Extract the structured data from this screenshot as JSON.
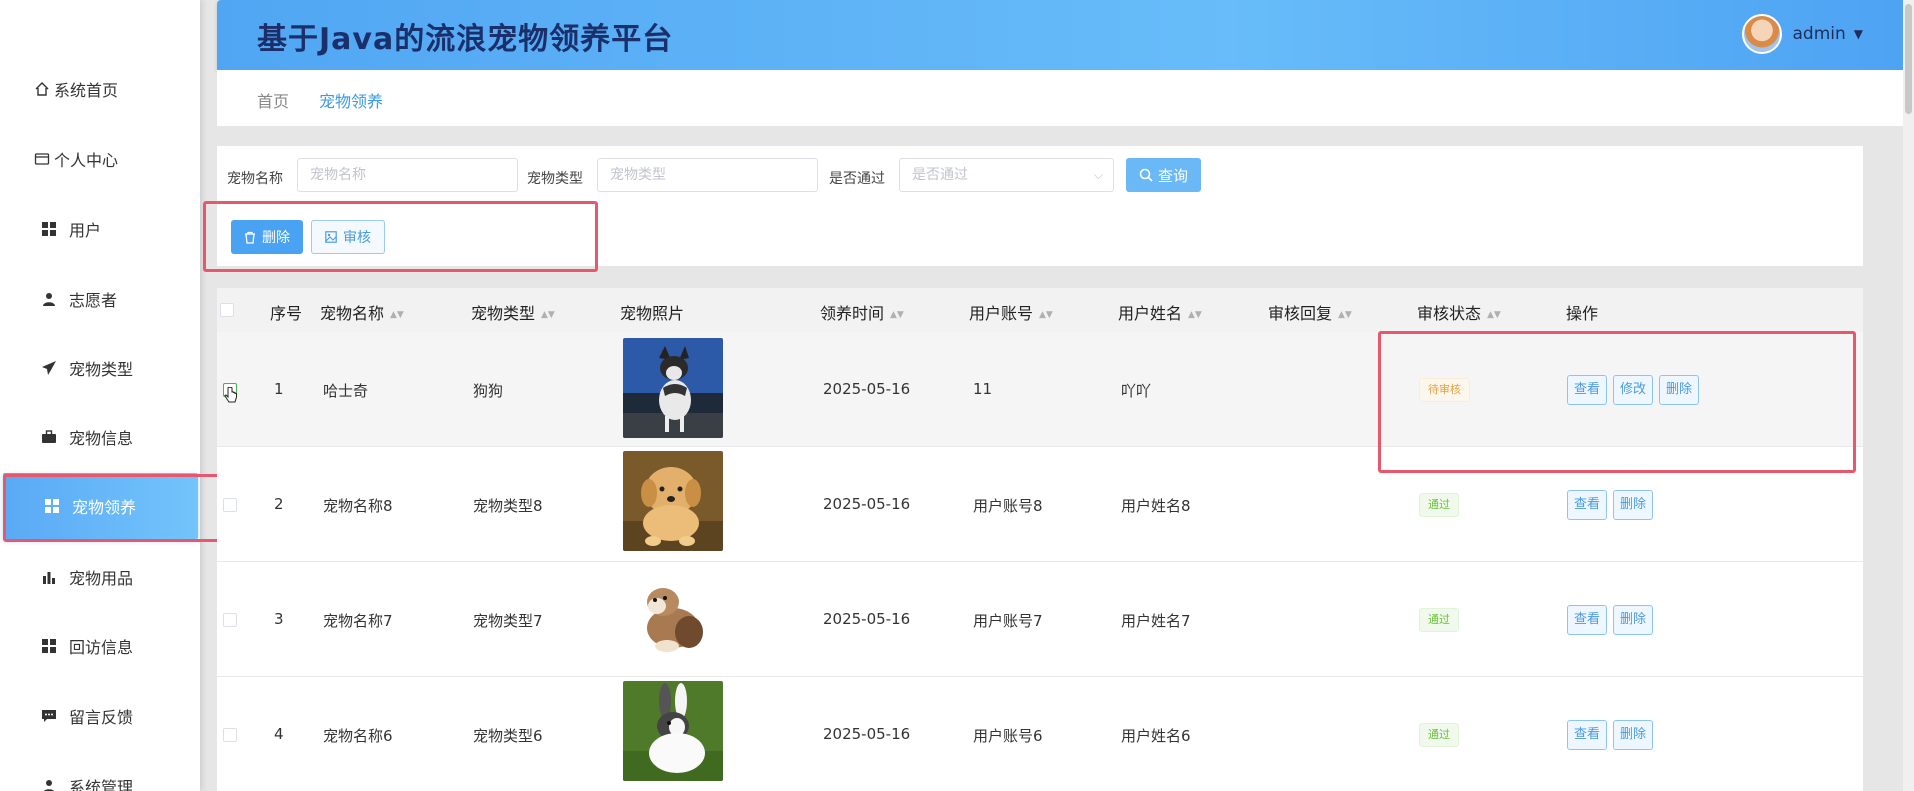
{
  "app": {
    "title": "基于Java的流浪宠物领养平台"
  },
  "user": {
    "name": "admin"
  },
  "sidebar": {
    "items": [
      {
        "label": "系统首页",
        "icon": "home-icon"
      },
      {
        "label": "个人中心",
        "icon": "card-icon"
      },
      {
        "label": "用户",
        "icon": "grid-icon"
      },
      {
        "label": "志愿者",
        "icon": "person-icon"
      },
      {
        "label": "宠物类型",
        "icon": "send-icon"
      },
      {
        "label": "宠物信息",
        "icon": "briefcase-icon"
      },
      {
        "label": "宠物领养",
        "icon": "grid-icon",
        "active": true
      },
      {
        "label": "宠物用品",
        "icon": "bar-chart-icon"
      },
      {
        "label": "回访信息",
        "icon": "grid-icon"
      },
      {
        "label": "留言反馈",
        "icon": "message-icon"
      },
      {
        "label": "系统管理",
        "icon": "person-icon"
      }
    ]
  },
  "breadcrumb": {
    "home": "首页",
    "current": "宠物领养"
  },
  "search": {
    "name_label": "宠物名称",
    "name_placeholder": "宠物名称",
    "type_label": "宠物类型",
    "type_placeholder": "宠物类型",
    "pass_label": "是否通过",
    "pass_placeholder": "是否通过",
    "query_label": "查询"
  },
  "actions": {
    "delete_label": "删除",
    "audit_label": "审核"
  },
  "table": {
    "headers": [
      "序号",
      "宠物名称",
      "宠物类型",
      "宠物照片",
      "领养时间",
      "用户账号",
      "用户姓名",
      "审核回复",
      "审核状态",
      "操作"
    ],
    "rows": [
      {
        "no": "1",
        "name": "哈士奇",
        "type": "狗狗",
        "photo": "husky",
        "date": "2025-05-16",
        "account": "11",
        "username": "吖吖",
        "reply": "",
        "status": "待审核",
        "ops": [
          "查看",
          "修改",
          "删除"
        ]
      },
      {
        "no": "2",
        "name": "宠物名称8",
        "type": "宠物类型8",
        "photo": "golden-puppy",
        "date": "2025-05-16",
        "account": "用户账号8",
        "username": "用户姓名8",
        "reply": "",
        "status": "通过",
        "ops": [
          "查看",
          "删除"
        ]
      },
      {
        "no": "3",
        "name": "宠物名称7",
        "type": "宠物类型7",
        "photo": "ferret",
        "date": "2025-05-16",
        "account": "用户账号7",
        "username": "用户姓名7",
        "reply": "",
        "status": "通过",
        "ops": [
          "查看",
          "删除"
        ]
      },
      {
        "no": "4",
        "name": "宠物名称6",
        "type": "宠物类型6",
        "photo": "rabbit",
        "date": "2025-05-16",
        "account": "用户账号6",
        "username": "用户姓名6",
        "reply": "",
        "status": "通过",
        "ops": [
          "查看",
          "删除"
        ]
      }
    ]
  },
  "colors": {
    "accent": "#4aa3f2",
    "header_start": "#51a6f3",
    "header_end": "#67bcf9",
    "highlight_frame": "#e8586c",
    "pending": "#e6a23c",
    "pass": "#67c23a"
  }
}
